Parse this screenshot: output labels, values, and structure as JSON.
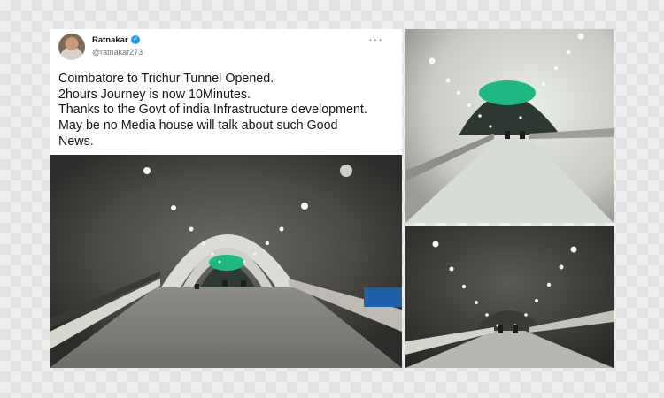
{
  "tweet": {
    "author_name": "Ratnakar",
    "author_handle": "@ratnakar273",
    "verified_icon": "verified-badge-icon",
    "more_icon": "more-options-icon",
    "text_lines": [
      "Coimbatore to Trichur Tunnel Opened.",
      "2hours Journey is now 10Minutes.",
      "Thanks to the Govt of india Infrastructure development.",
      "May be no Media house will talk about such Good",
      "News."
    ]
  },
  "colors": {
    "tunnel_light": "#dfe4dc",
    "tunnel_dark": "#2b2a28",
    "tunnel_exit_green": "#1fb882",
    "verified_blue": "#1da1f2"
  }
}
